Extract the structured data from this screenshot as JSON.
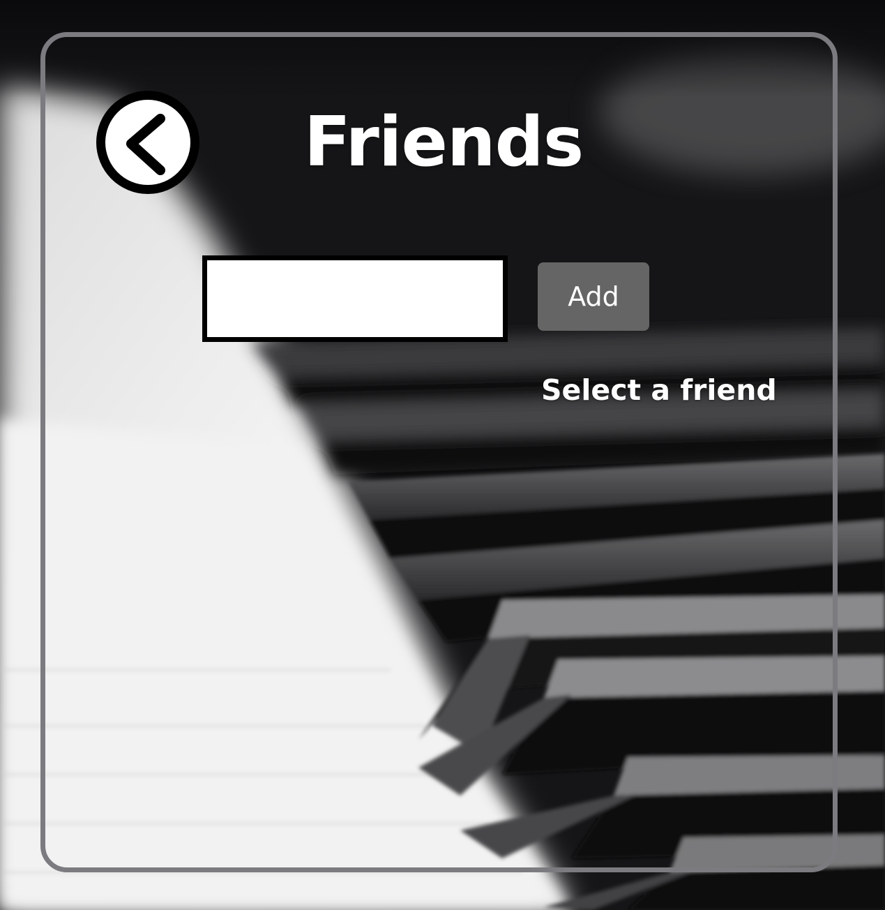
{
  "screen": {
    "title": "Friends",
    "back_icon": "chevron-left-icon"
  },
  "add_friend": {
    "input_value": "",
    "input_placeholder": "",
    "add_label": "Add"
  },
  "friends_list": {
    "prompt": "Select a friend"
  },
  "colors": {
    "panel_border": "#7c7b80",
    "add_button": "#656565",
    "text": "#ffffff"
  }
}
